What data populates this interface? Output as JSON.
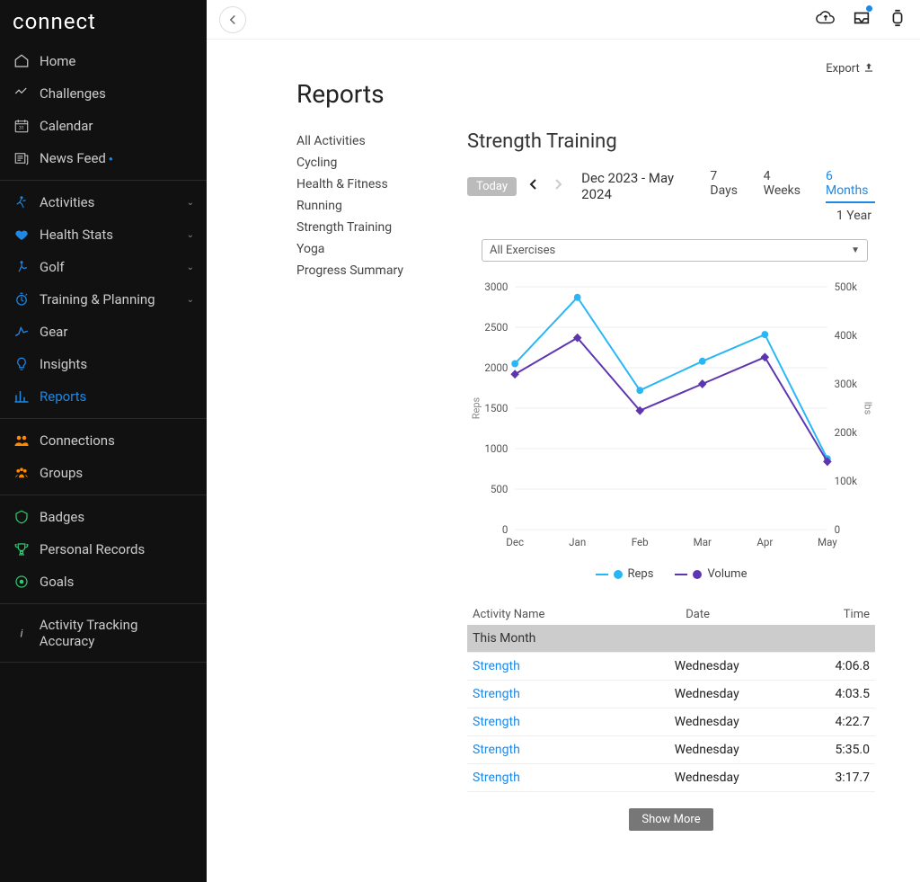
{
  "brand": "connect",
  "sidebar": {
    "sections": [
      {
        "items": [
          {
            "icon": "home",
            "label": "Home"
          },
          {
            "icon": "chart",
            "label": "Challenges"
          },
          {
            "icon": "calendar",
            "label": "Calendar"
          },
          {
            "icon": "newsfeed",
            "label": "News Feed",
            "dot": true
          }
        ]
      },
      {
        "items": [
          {
            "icon": "activities",
            "label": "Activities",
            "caret": true,
            "color": "#1e88e5"
          },
          {
            "icon": "heart",
            "label": "Health Stats",
            "caret": true,
            "color": "#1e88e5"
          },
          {
            "icon": "golf",
            "label": "Golf",
            "caret": true,
            "color": "#1e88e5"
          },
          {
            "icon": "stopwatch",
            "label": "Training & Planning",
            "caret": true,
            "color": "#1e88e5"
          },
          {
            "icon": "gear",
            "label": "Gear",
            "color": "#1e88e5"
          },
          {
            "icon": "bulb",
            "label": "Insights",
            "color": "#1e88e5"
          },
          {
            "icon": "reports",
            "label": "Reports",
            "active": true,
            "color": "#1e88e5"
          }
        ]
      },
      {
        "items": [
          {
            "icon": "users",
            "label": "Connections",
            "color": "#ff8a00"
          },
          {
            "icon": "groups",
            "label": "Groups",
            "color": "#ff8a00"
          }
        ]
      },
      {
        "items": [
          {
            "icon": "badge",
            "label": "Badges",
            "color": "#2ecc71"
          },
          {
            "icon": "trophy",
            "label": "Personal Records",
            "color": "#2ecc71"
          },
          {
            "icon": "target",
            "label": "Goals",
            "color": "#2ecc71"
          }
        ]
      },
      {
        "items": [
          {
            "icon": "info",
            "label": "Activity Tracking Accuracy"
          }
        ]
      }
    ]
  },
  "export_label": "Export",
  "page_title": "Reports",
  "report_nav": [
    "All Activities",
    "Cycling",
    "Health & Fitness",
    "Running",
    "Strength Training",
    "Yoga",
    "Progress Summary"
  ],
  "report_heading": "Strength Training",
  "today_label": "Today",
  "date_range": "Dec 2023 - May 2024",
  "range_tabs": [
    "7 Days",
    "4 Weeks",
    "6 Months",
    "1 Year"
  ],
  "range_active": "6 Months",
  "exercise_select": "All Exercises",
  "chart_data": {
    "type": "line",
    "categories": [
      "Dec",
      "Jan",
      "Feb",
      "Mar",
      "Apr",
      "May"
    ],
    "series": [
      {
        "name": "Reps",
        "axis": "left",
        "values": [
          2050,
          2870,
          1720,
          2080,
          2410,
          875
        ],
        "color": "#29b6f6"
      },
      {
        "name": "Volume",
        "axis": "right",
        "values": [
          320000,
          395000,
          245000,
          300000,
          355000,
          140000
        ],
        "color": "#5e35b1"
      }
    ],
    "left_axis": {
      "label": "Reps",
      "ticks": [
        0,
        500,
        1000,
        1500,
        2000,
        2500,
        3000
      ]
    },
    "right_axis": {
      "label": "lbs",
      "ticks": [
        0,
        100000,
        200000,
        300000,
        400000,
        500000
      ],
      "tick_labels": [
        "0",
        "100k",
        "200k",
        "300k",
        "400k",
        "500k"
      ]
    }
  },
  "legend": [
    "Reps",
    "Volume"
  ],
  "table": {
    "columns": [
      "Activity Name",
      "Date",
      "Time"
    ],
    "section": "This Month",
    "rows": [
      {
        "name": "Strength",
        "date": "Wednesday",
        "time": "4:06.8"
      },
      {
        "name": "Strength",
        "date": "Wednesday",
        "time": "4:03.5"
      },
      {
        "name": "Strength",
        "date": "Wednesday",
        "time": "4:22.7"
      },
      {
        "name": "Strength",
        "date": "Wednesday",
        "time": "5:35.0"
      },
      {
        "name": "Strength",
        "date": "Wednesday",
        "time": "3:17.7"
      }
    ]
  },
  "show_more": "Show More"
}
